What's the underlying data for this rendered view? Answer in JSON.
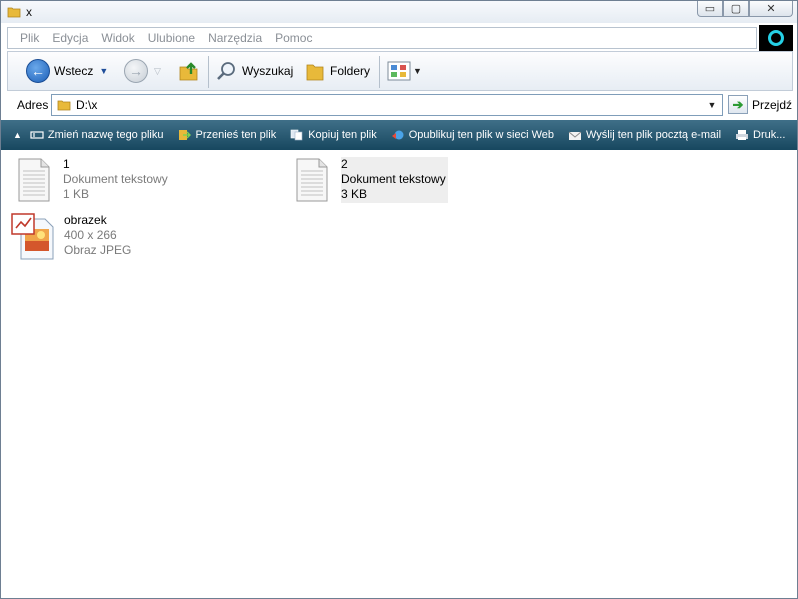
{
  "window": {
    "title": "x",
    "controls": {
      "minimize": "▭",
      "maximize": "▢",
      "close": "✕"
    }
  },
  "menu": {
    "items": [
      "Plik",
      "Edycja",
      "Widok",
      "Ulubione",
      "Narzędzia",
      "Pomoc"
    ]
  },
  "toolbar": {
    "back_label": "Wstecz",
    "search_label": "Wyszukaj",
    "folders_label": "Foldery"
  },
  "address": {
    "label": "Adres",
    "value": "D:\\x",
    "go_label": "Przejdź"
  },
  "tasks": {
    "collapse": "▲",
    "items": [
      {
        "label": "Zmień nazwę tego pliku",
        "icon": "rename-icon"
      },
      {
        "label": "Przenieś ten plik",
        "icon": "move-file-icon"
      },
      {
        "label": "Kopiuj ten plik",
        "icon": "copy-file-icon"
      },
      {
        "label": "Opublikuj ten plik w sieci Web",
        "icon": "publish-web-icon"
      },
      {
        "label": "Wyślij ten plik pocztą e-mail",
        "icon": "email-icon"
      },
      {
        "label": "Druk...",
        "icon": "print-icon"
      }
    ]
  },
  "files": [
    {
      "name": "1",
      "line2": "Dokument tekstowy",
      "line3": "1 KB",
      "icon": "text-document-icon",
      "selected": false
    },
    {
      "name": "2",
      "line2": "Dokument tekstowy",
      "line3": "3 KB",
      "icon": "text-document-icon",
      "selected": true
    },
    {
      "name": "obrazek",
      "line2": "400 x 266",
      "line3": "Obraz JPEG",
      "icon": "jpeg-image-icon",
      "selected": false
    }
  ],
  "colors": {
    "taskbar": "#17475f",
    "back_button": "#1c5fb8",
    "folder": "#e8b93a"
  }
}
